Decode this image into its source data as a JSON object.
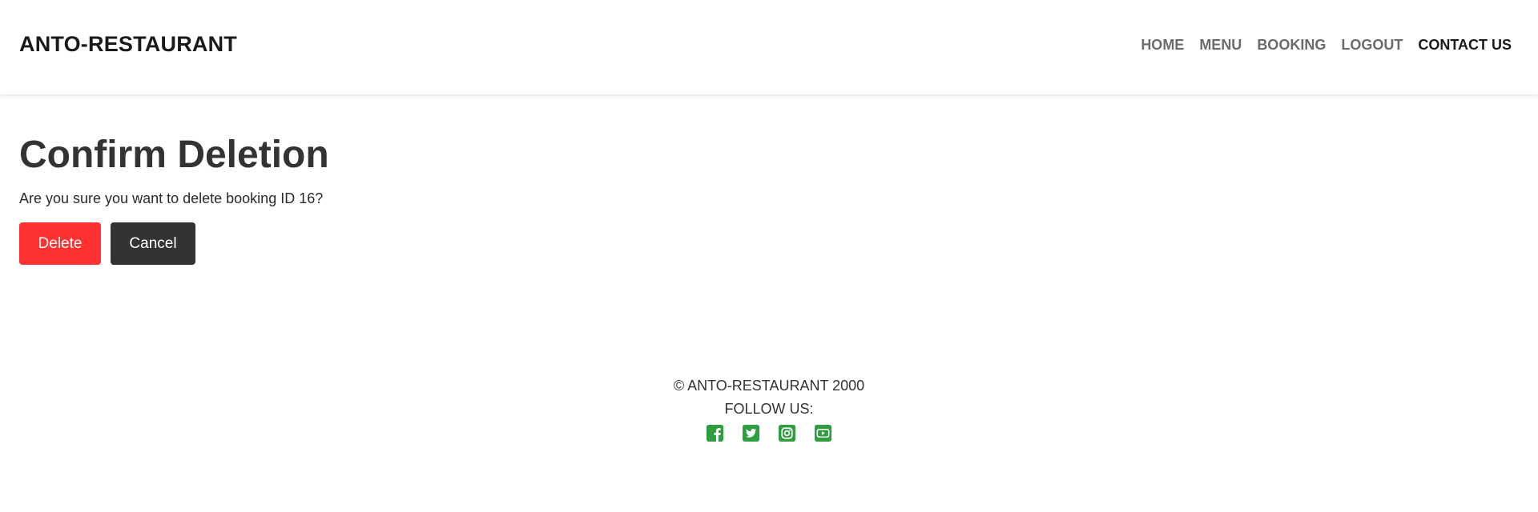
{
  "header": {
    "brand": "ANTO-RESTAURANT",
    "nav": [
      {
        "label": "HOME"
      },
      {
        "label": "MENU"
      },
      {
        "label": "BOOKING"
      },
      {
        "label": "LOGOUT"
      },
      {
        "label": "CONTACT US"
      }
    ]
  },
  "main": {
    "title": "Confirm Deletion",
    "message": "Are you sure you want to delete booking ID 16?",
    "delete_label": "Delete",
    "cancel_label": "Cancel"
  },
  "footer": {
    "copyright": "© ANTO-RESTAURANT 2000",
    "follow": "FOLLOW US:",
    "social_icons": [
      "facebook-icon",
      "twitter-icon",
      "instagram-icon",
      "youtube-icon"
    ],
    "icon_color": "#2e9e3f"
  },
  "colors": {
    "delete_button": "#ff3131",
    "cancel_button": "#333333"
  }
}
